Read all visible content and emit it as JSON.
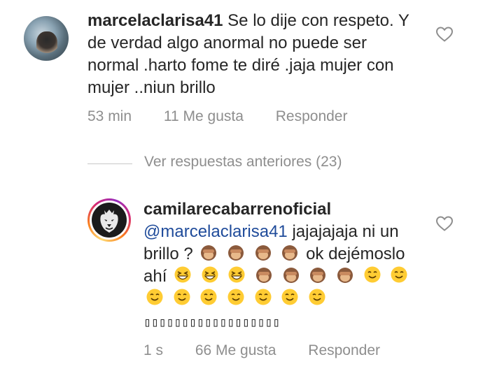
{
  "comments": [
    {
      "username": "marcelaclarisa41",
      "text": "Se lo dije con respeto. Y de verdad algo anormal no puede ser normal .harto fome te diré .jaja mujer con mujer ..niun brillo",
      "time": "53 min",
      "likes": "11 Me gusta",
      "reply_label": "Responder"
    },
    {
      "username": "camilarecabarrenoficial",
      "mention": "@marcelaclarisa41",
      "text_part1": "jajajajaja ni un brillo ?",
      "text_part2": "ok dejémoslo ahí",
      "boxes": "▯▯▯▯▯▯▯▯▯▯▯▯▯▯▯▯▯▯",
      "time": "1 s",
      "likes": "66 Me gusta",
      "reply_label": "Responder"
    }
  ],
  "view_replies": "Ver respuestas anteriores (23)",
  "icons": {
    "heart": "heart-icon",
    "monkey": "see-no-evil-monkey-emoji",
    "laugh": "grinning-squinting-face-emoji",
    "smile": "smiling-face-emoji"
  },
  "colors": {
    "text": "#262626",
    "meta": "#8e8e8e",
    "mention": "#1f4b9a"
  }
}
